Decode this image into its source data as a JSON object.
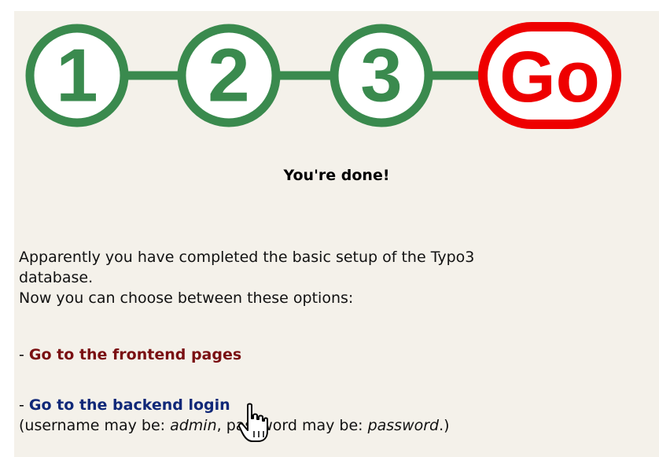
{
  "steps": [
    {
      "label": "1",
      "color": "#3a8a4e"
    },
    {
      "label": "2",
      "color": "#3a8a4e"
    },
    {
      "label": "3",
      "color": "#3a8a4e"
    },
    {
      "label": "Go",
      "color": "#ee0000"
    }
  ],
  "heading": "You're done!",
  "intro": {
    "line1": "Apparently you have completed the basic setup of the Typo3",
    "line2": "database.",
    "line3": "Now you can choose between these options:"
  },
  "options": {
    "frontend": {
      "dash": "- ",
      "link": "Go to the frontend pages"
    },
    "backend": {
      "dash": "- ",
      "link": "Go to the backend login"
    }
  },
  "note": {
    "prefix": "(username may be: ",
    "username": "admin",
    "middle": ", password may be: ",
    "password": "password",
    "suffix": ".)"
  },
  "colors": {
    "background": "#f4f1ea",
    "step_green": "#3a8a4e",
    "go_red": "#ee0000",
    "frontend_link": "#7a0f12",
    "backend_link": "#102878"
  },
  "icons": [
    "hand-pointer-cursor-icon"
  ]
}
